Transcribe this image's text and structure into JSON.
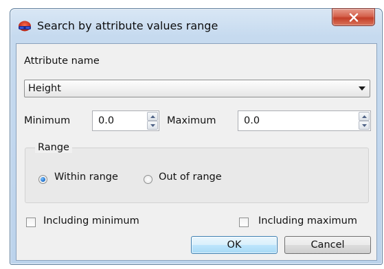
{
  "dialog": {
    "title": "Search by attribute values range",
    "app_icon": "glasses-icon",
    "close_icon": "close-icon",
    "close_button_color": "#c43f29"
  },
  "attribute": {
    "label": "Attribute name",
    "selected": "Height",
    "dropdown_icon": "chevron-down-icon"
  },
  "minimum": {
    "label": "Minimum",
    "value": "0.0"
  },
  "maximum": {
    "label": "Maximum",
    "value": "0.0"
  },
  "range": {
    "title": "Range",
    "options": [
      {
        "label": "Within range",
        "checked": true
      },
      {
        "label": "Out of range",
        "checked": false
      }
    ]
  },
  "including_minimum": {
    "label": "Including minimum",
    "checked": false
  },
  "including_maximum": {
    "label": "Including maximum",
    "checked": false
  },
  "buttons": {
    "ok": "OK",
    "cancel": "Cancel"
  }
}
